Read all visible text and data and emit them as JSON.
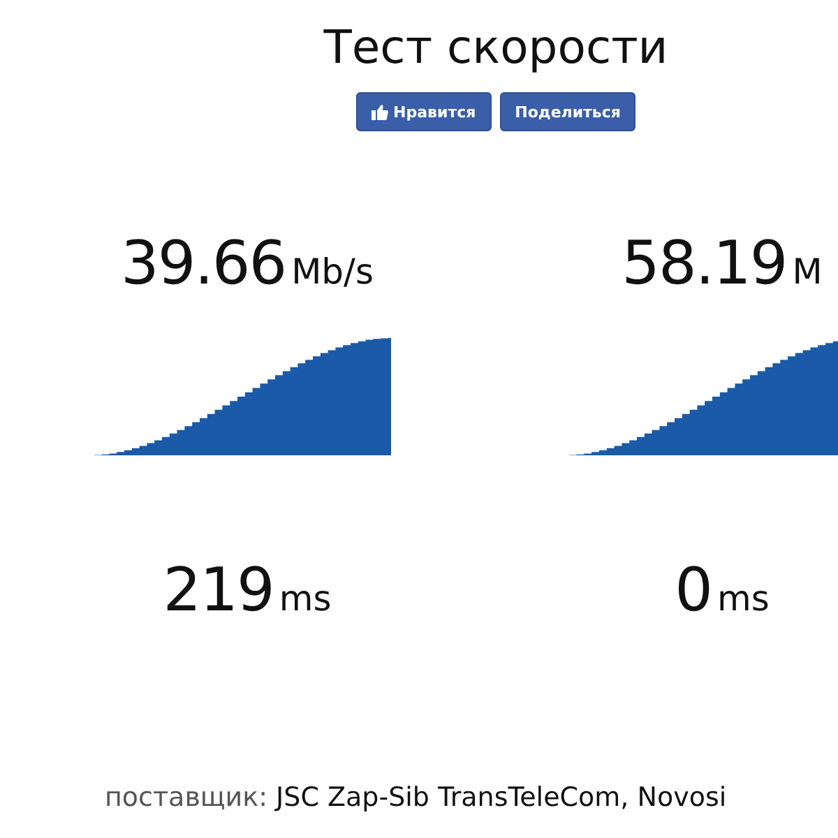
{
  "title": "Тест скорости",
  "buttons": [
    {
      "kind": "like",
      "label": "Нравится"
    },
    {
      "kind": "share",
      "label": "Поделиться"
    }
  ],
  "results": [
    {
      "speed": "39.66",
      "speed_unit": "Mb/s",
      "ping": "219",
      "ping_unit": "ms"
    },
    {
      "speed": "58.19",
      "speed_unit": "M",
      "ping": "0",
      "ping_unit": "ms"
    }
  ],
  "provider": {
    "label": "поставщик:",
    "value": "JSC Zap-Sib TransTeleCom, Novosi"
  }
}
